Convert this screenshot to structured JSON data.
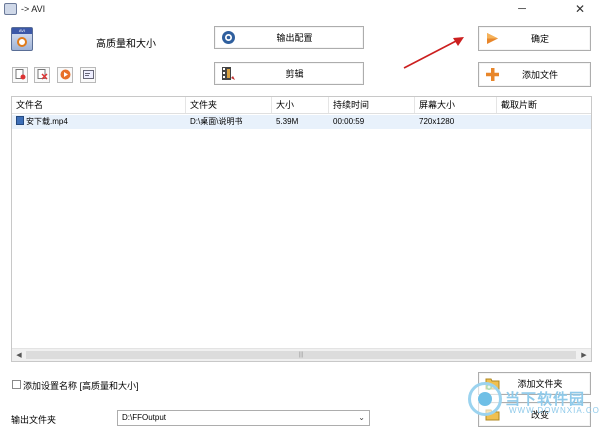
{
  "window": {
    "title": "-> AVI",
    "minimize": "─",
    "close": "✕"
  },
  "profile": {
    "label": "高质量和大小",
    "icon": "avi-file-icon"
  },
  "buttons": {
    "output_config": "输出配置",
    "edit": "剪辑",
    "ok": "确定",
    "add_file": "添加文件",
    "add_folder": "添加文件夹",
    "change": "改变"
  },
  "toolbar_icons": [
    "remove-file-icon",
    "clear-list-icon",
    "play-icon",
    "media-info-icon"
  ],
  "table": {
    "headers": [
      "文件名",
      "文件夹",
      "大小",
      "持续时间",
      "屏幕大小",
      "截取片断"
    ],
    "rows": [
      {
        "name": "安下载.mp4",
        "folder": "D:\\桌面\\说明书",
        "size": "5.39M",
        "duration": "00:00:59",
        "screen": "720x1280",
        "clip": ""
      }
    ]
  },
  "options": {
    "add_setting_name": "添加设置名称 [高质量和大小]",
    "checked": false
  },
  "output": {
    "label": "输出文件夹",
    "value": "D:\\FFOutput"
  },
  "watermark": {
    "text": "当下软件园",
    "sub": "WWW.DOWNXIA.COM"
  },
  "colors": {
    "arrow": "#cc1f1f",
    "selected_row": "#e8f1fb",
    "watermark": "#8fcaea"
  }
}
